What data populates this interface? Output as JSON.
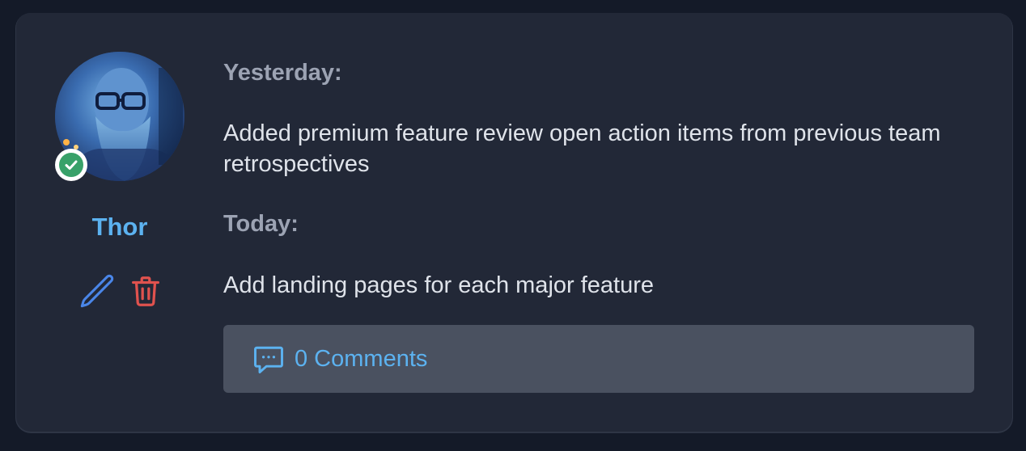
{
  "user": {
    "name": "Thor",
    "status": "online",
    "status_color": "#38a169"
  },
  "actions": {
    "edit_icon": "pencil-icon",
    "delete_icon": "trash-icon",
    "edit_color": "#4a86e8",
    "delete_color": "#e0524e"
  },
  "standup": {
    "yesterday_label": "Yesterday:",
    "yesterday_text": "Added premium feature review open action items from previous team retrospectives",
    "today_label": "Today:",
    "today_text": "Add landing pages for each major feature"
  },
  "comments": {
    "icon": "chat-bubble-icon",
    "label": "0 Comments"
  },
  "colors": {
    "accent": "#5cb2f0",
    "card_bg": "#222837",
    "page_bg": "#141a28"
  }
}
